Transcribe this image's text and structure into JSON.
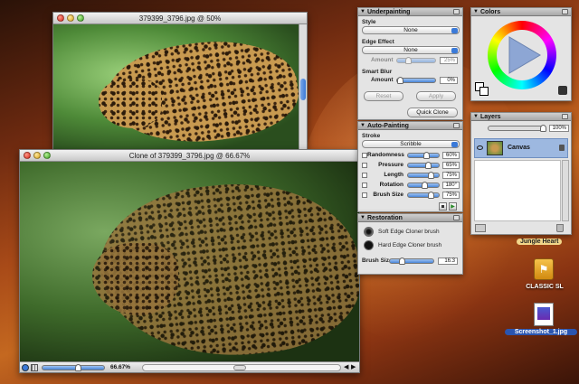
{
  "window_back": {
    "title": "379399_3796.jpg @ 50%"
  },
  "window_front": {
    "title": "Clone of 379399_3796.jpg @ 66.67%",
    "zoom": "66.67%"
  },
  "underpainting": {
    "header": "Underpainting",
    "style_label": "Style",
    "style_value": "None",
    "edge_label": "Edge Effect",
    "edge_value": "None",
    "amount_label": "Amount",
    "amount_value": "25%",
    "smart_blur_label": "Smart Blur",
    "blur_amount_label": "Amount",
    "blur_amount_value": "0%",
    "reset_label": "Reset",
    "apply_label": "Apply",
    "quick_clone_label": "Quick Clone"
  },
  "autopainting": {
    "header": "Auto-Painting",
    "stroke_label": "Stroke",
    "stroke_value": "Scribble",
    "rows": [
      {
        "label": "Randomness",
        "value": "60%",
        "level": 0.6
      },
      {
        "label": "Pressure",
        "value": "65%",
        "level": 0.65
      },
      {
        "label": "Length",
        "value": "75%",
        "level": 0.75
      },
      {
        "label": "Rotation",
        "value": "180°",
        "level": 0.5
      },
      {
        "label": "Brush Size",
        "value": "75%",
        "level": 0.75
      }
    ]
  },
  "restoration": {
    "header": "Restoration",
    "brush1": "Soft Edge Cloner brush",
    "brush2": "Hard Edge Cloner brush",
    "brush_size_label": "Brush Size:",
    "brush_size_value": "16.3"
  },
  "colors": {
    "header": "Colors"
  },
  "layers": {
    "header": "Layers",
    "opacity": "100%",
    "canvas_label": "Canvas"
  },
  "desktop": {
    "jungle_label": "Jungle Heart",
    "classic_label": "CLASSIC SL",
    "screenshot_label": "Screenshot_1.jpg"
  },
  "colors_accent": {
    "highlight": "#3b7ad8",
    "layer_selected": "#9db8e0"
  }
}
